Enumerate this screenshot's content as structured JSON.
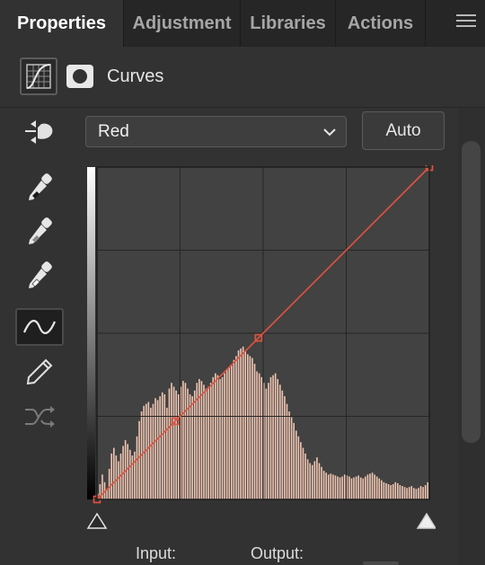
{
  "tabs": [
    {
      "label": "Properties",
      "active": true
    },
    {
      "label": "Adjustment",
      "active": false
    },
    {
      "label": "Libraries",
      "active": false
    },
    {
      "label": "Actions",
      "active": false
    }
  ],
  "panel_menu_icon": "hamburger-menu-icon",
  "header": {
    "title": "Curves",
    "icons": [
      "curves-adjustment-icon",
      "layer-mask-icon"
    ]
  },
  "toolbar": [
    {
      "name": "on-image-adjust-icon",
      "active": false
    },
    {
      "name": "black-point-eyedropper-icon",
      "active": false
    },
    {
      "name": "gray-point-eyedropper-icon",
      "active": false
    },
    {
      "name": "white-point-eyedropper-icon",
      "active": false
    },
    {
      "name": "edit-points-curve-icon",
      "active": true
    },
    {
      "name": "draw-curve-pencil-icon",
      "active": false
    },
    {
      "name": "smooth-curve-icon",
      "active": false
    }
  ],
  "channel_select": {
    "value": "Red",
    "icon": "chevron-down-icon"
  },
  "auto_label": "Auto",
  "curve": {
    "channel_color": "#e05540",
    "histogram_color": "#f2c7b3",
    "grid_divisions": 4,
    "points": [
      [
        0,
        0
      ],
      [
        60,
        60
      ],
      [
        124,
        124
      ],
      [
        255,
        255
      ]
    ],
    "histogram": [
      6,
      16,
      26,
      18,
      10,
      32,
      48,
      54,
      46,
      40,
      48,
      56,
      62,
      58,
      52,
      46,
      50,
      66,
      82,
      92,
      98,
      100,
      102,
      96,
      100,
      106,
      104,
      108,
      112,
      110,
      96,
      116,
      122,
      118,
      114,
      110,
      118,
      124,
      122,
      116,
      110,
      108,
      114,
      122,
      126,
      124,
      120,
      116,
      118,
      122,
      128,
      132,
      130,
      126,
      128,
      132,
      136,
      138,
      140,
      146,
      150,
      156,
      158,
      160,
      156,
      152,
      150,
      148,
      142,
      134,
      132,
      128,
      122,
      116,
      122,
      128,
      130,
      132,
      126,
      120,
      114,
      108,
      100,
      92,
      86,
      80,
      72,
      66,
      60,
      54,
      48,
      42,
      38,
      36,
      40,
      44,
      38,
      34,
      30,
      28,
      26,
      27,
      26,
      25,
      24,
      23,
      24,
      26,
      25,
      24,
      22,
      23,
      24,
      25,
      23,
      22,
      24,
      26,
      27,
      28,
      26,
      24,
      22,
      20,
      18,
      17,
      16,
      15,
      16,
      18,
      17,
      15,
      14,
      13,
      12,
      13,
      14,
      12,
      11,
      12,
      14,
      13,
      15,
      18
    ],
    "input_slider_points": [
      0,
      255
    ]
  },
  "input_label": "Input:",
  "output_label": "Output:"
}
